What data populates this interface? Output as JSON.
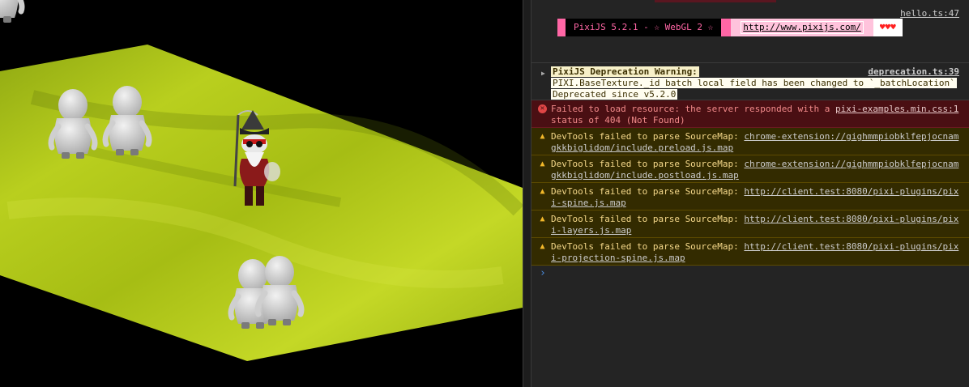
{
  "console": {
    "banner": {
      "source": "hello.ts:47",
      "label": "PixiJS 5.2.1 - ☆ WebGL 2 ☆",
      "url": "http://www.pixijs.com/",
      "hearts": "♥♥♥"
    },
    "deprecation": {
      "source": "deprecation.ts:39",
      "title": "PixiJS Deprecation Warning:",
      "line1": "PIXI.BaseTexture._id batch local field has been changed to `_batchLocation`",
      "line2": "Deprecated since v5.2.0"
    },
    "error": {
      "text_before": "Failed to load resource: the server responded with a ",
      "link": "pixi-examples.min.css:1",
      "text_after": "status of 404 (Not Found)"
    },
    "warnings": [
      {
        "text": "DevTools failed to parse SourceMap: ",
        "link1": "chrome-extension://gighmmpiobklfepjocnam",
        "link2": "gkkbiglidom/include.preload.js.map"
      },
      {
        "text": "DevTools failed to parse SourceMap: ",
        "link1": "chrome-extension://gighmmpiobklfepjocnam",
        "link2": "gkkbiglidom/include.postload.js.map"
      },
      {
        "text": "DevTools failed to parse SourceMap: ",
        "link1": "http://client.test:8080/pixi-plugins/pix",
        "link2": "i-spine.js.map"
      },
      {
        "text": "DevTools failed to parse SourceMap: ",
        "link1": "http://client.test:8080/pixi-plugins/pix",
        "link2": "i-layers.js.map"
      },
      {
        "text": "DevTools failed to parse SourceMap: ",
        "link1": "http://client.test:8080/pixi-plugins/pix",
        "link2": "i-projection-spine.js.map"
      }
    ],
    "prompt": "›"
  },
  "colors": {
    "ground": "#b2c81a",
    "ground_dark": "#8aa010",
    "pixi_pink": "#ff66a5"
  }
}
